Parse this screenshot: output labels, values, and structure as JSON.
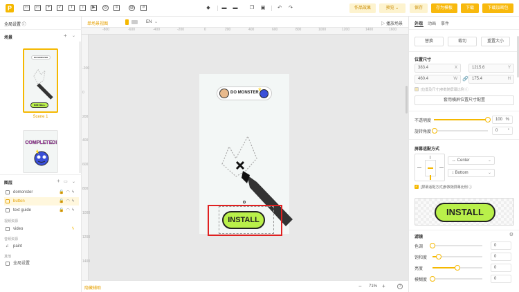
{
  "toolbar": {
    "logo": "P",
    "tools": [
      "image-icon",
      "image-icon",
      "box-icon",
      "check-icon",
      "text-icon",
      "sound-icon",
      "video-icon",
      "web-icon",
      "at-icon",
      "grid-icon"
    ],
    "buttons": {
      "works_effect": "作品效果",
      "preview": "预览 ⌄",
      "save": "保存",
      "save_as_template": "存为模板",
      "download": "下载",
      "download_enc": "下载加密包"
    }
  },
  "left": {
    "global_settings": "全局设置 ⓘ",
    "scenes_title": "场景",
    "scene1_label": "Scene 1",
    "scene1_brand": "DO MONSTER",
    "scene1_install": "INSTALL",
    "scene2_completed": "COMPLETED!",
    "layers_title": "图层",
    "layers": [
      {
        "name": "domonster"
      },
      {
        "name": "button"
      },
      {
        "name": "text guide"
      }
    ],
    "video_group": "视频资源",
    "video_item": "video",
    "bg_group": "音频资源",
    "paint_item": "paint",
    "other_group": "其他",
    "global_item": "全局设置"
  },
  "canvas": {
    "tab_single": "单场景视图",
    "lang": "EN",
    "play_scene": "▷ 播放场景",
    "ruler_x": [
      "-800",
      "-600",
      "-400",
      "-200",
      "0",
      "200",
      "400",
      "600",
      "800",
      "1000",
      "1200",
      "1400",
      "1600"
    ],
    "ruler_y": [
      "-200",
      "0",
      "200",
      "400",
      "600",
      "800",
      "1000",
      "1200",
      "1400",
      "1600"
    ],
    "brand": "DO MONSTER",
    "install": "INSTALL",
    "footer_left": "隐藏辅助",
    "zoom": "71%",
    "zoom_minus": "−",
    "zoom_plus": "+",
    "help": "?"
  },
  "right": {
    "tabs": [
      "外观",
      "动画",
      "事件"
    ],
    "btn_replace": "替换",
    "btn_crop": "裁切",
    "btn_reset": "重置大小",
    "pos_title": "位置尺寸",
    "x": "383.4",
    "x_suf": "X",
    "y": "1215.6",
    "y_suf": "Y",
    "w": "460.4",
    "w_suf": "W",
    "h": "175.4",
    "h_suf": "H",
    "check_pos": "[位置及尺寸]参数随屏幕比例 ⓘ",
    "apply_btn": "套用横屏位置尺寸配置",
    "opacity_label": "不透明度",
    "opacity_value": "100",
    "opacity_unit": "%",
    "opacity": 1.0,
    "rotation_label": "旋转角度",
    "rotation_value": "0",
    "rotation_unit": "°",
    "fit_title": "屏幕适配方式",
    "h_align": "↔ Center",
    "v_align": "↕ Bottom",
    "check_fit": "[屏幕适配方式]参数随屏幕比例 ⓘ",
    "preview_install": "INSTALL",
    "filter_title": "滤镜",
    "filters": [
      {
        "label": "色调",
        "value": "0",
        "level": 0.0
      },
      {
        "label": "饱和度",
        "value": "0",
        "level": 0.12
      },
      {
        "label": "亮度",
        "value": "0",
        "level": 0.5
      },
      {
        "label": "模糊度",
        "value": "0",
        "level": 0.0
      }
    ],
    "accent": "#f5b800"
  }
}
